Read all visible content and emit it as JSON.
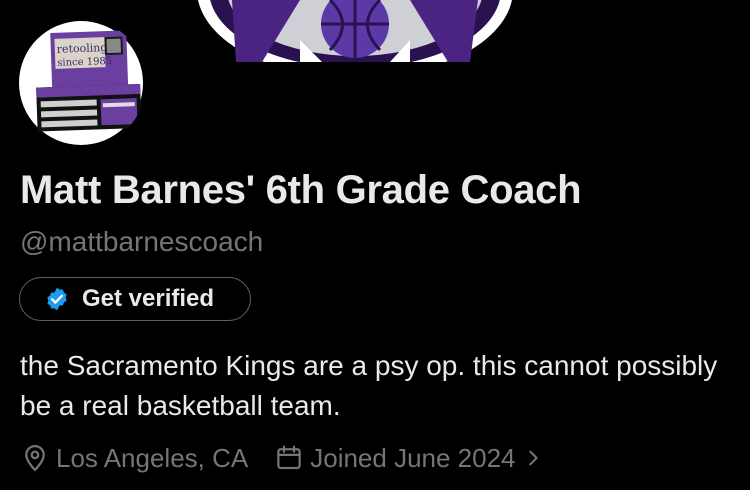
{
  "profile": {
    "display_name": "Matt Barnes' 6th Grade Coach",
    "handle": "@mattbarnescoach",
    "bio": "the Sacramento Kings are a psy op. this cannot possibly be a real basketball team.",
    "location": "Los Angeles, CA",
    "joined": "Joined June 2024"
  },
  "avatar": {
    "sign_line1": "retooling",
    "sign_line2": "since 1985"
  },
  "verify": {
    "label": "Get verified",
    "badge_color": "#1d9bf0"
  },
  "icons": {
    "location": "location-pin-icon",
    "calendar": "calendar-icon",
    "chevron": "chevron-right-icon",
    "verified": "verified-badge-icon"
  },
  "colors": {
    "background": "#000000",
    "primary_text": "#e7e9ea",
    "secondary_text": "#71767b",
    "logo_purple": "#5a2d9c"
  }
}
